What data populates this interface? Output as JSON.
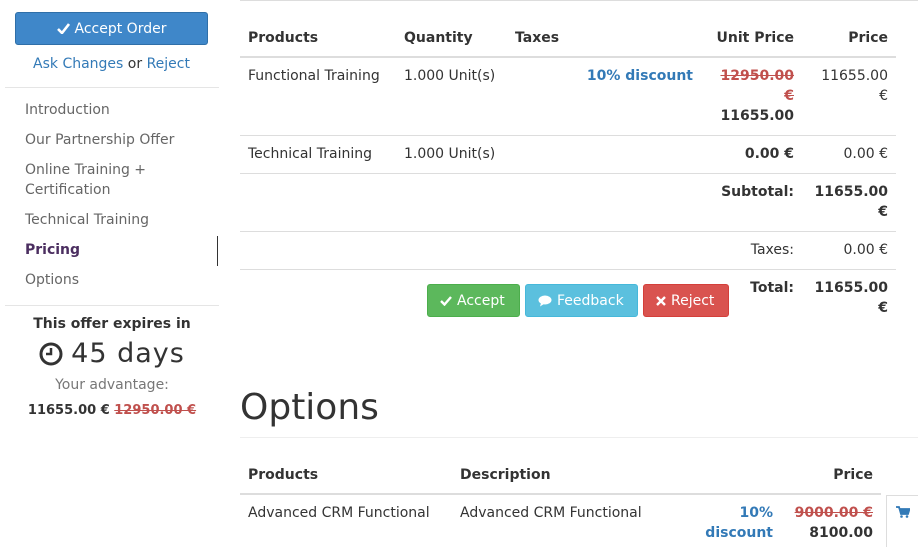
{
  "sidebar": {
    "accept_order_label": "Accept Order",
    "ask_changes": "Ask Changes",
    "or": "or",
    "reject": "Reject",
    "nav": [
      {
        "label": "Introduction"
      },
      {
        "label": "Our Partnership Offer"
      },
      {
        "label": "Online Training + Certification"
      },
      {
        "label": "Technical Training"
      },
      {
        "label": "Pricing"
      },
      {
        "label": "Options"
      }
    ],
    "expires_title": "This offer expires in",
    "expires_days": "45 days",
    "advantage_label": "Your advantage:",
    "advantage_value": "11655.00 €",
    "advantage_old": "12950.00 €"
  },
  "pricing": {
    "headers": [
      "Products",
      "Quantity",
      "Taxes",
      "Unit Price",
      "Price"
    ],
    "rows": [
      {
        "product": "Functional Training",
        "quantity": "1.000 Unit(s)",
        "discount": "10% discount",
        "unit_old": "12950.00 €",
        "unit": "11655.00",
        "price": "11655.00 €"
      },
      {
        "product": "Technical Training",
        "quantity": "1.000 Unit(s)",
        "unit": "0.00 €",
        "price": "0.00 €"
      }
    ],
    "subtotal_label": "Subtotal:",
    "subtotal_value": "11655.00 €",
    "taxes_label": "Taxes:",
    "taxes_value": "0.00 €",
    "total_label": "Total:",
    "total_value": "11655.00 €"
  },
  "actions": {
    "accept": "Accept",
    "feedback": "Feedback",
    "reject": "Reject"
  },
  "options": {
    "title": "Options",
    "headers": [
      "Products",
      "Description",
      "Price"
    ],
    "rows": [
      {
        "product": "Advanced CRM Functional",
        "description": "Advanced CRM Functional",
        "discount": "10% discount",
        "price_old": "9000.00 €",
        "price": "8100.00"
      }
    ]
  },
  "colors": {
    "primary": "#3f87c9",
    "success": "#5cb85c",
    "info": "#5bc0de",
    "danger": "#d9534f",
    "link": "#337ab7",
    "strike": "#c0504d"
  }
}
